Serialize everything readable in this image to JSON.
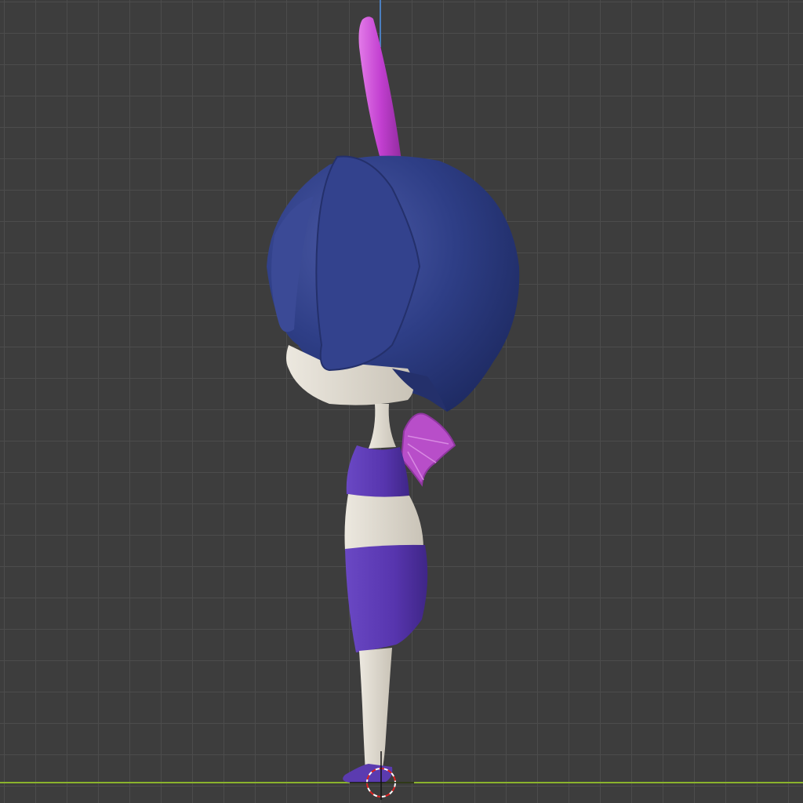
{
  "app": "3D viewport",
  "view": {
    "projection": "orthographic",
    "orientation": "side",
    "grid": true,
    "grid_color": "#4a4a4a",
    "background_color": "#3d3d3d",
    "axis_colors": {
      "vertical_axis": "#4b7fbf",
      "horizontal_axis": "#8ab32c"
    }
  },
  "scene": {
    "object": "chibi-character-model",
    "parts": [
      "horn",
      "hair",
      "face",
      "neck",
      "crop-top",
      "wing",
      "waist",
      "shorts",
      "leg",
      "shoe"
    ],
    "colors": {
      "hair": "#2b3a7e",
      "horn": "#c23fd0",
      "wing": "#b84ec9",
      "skin": "#dcd7cd",
      "clothing": "#5b3bb0"
    },
    "cursor": "3d-cursor"
  }
}
